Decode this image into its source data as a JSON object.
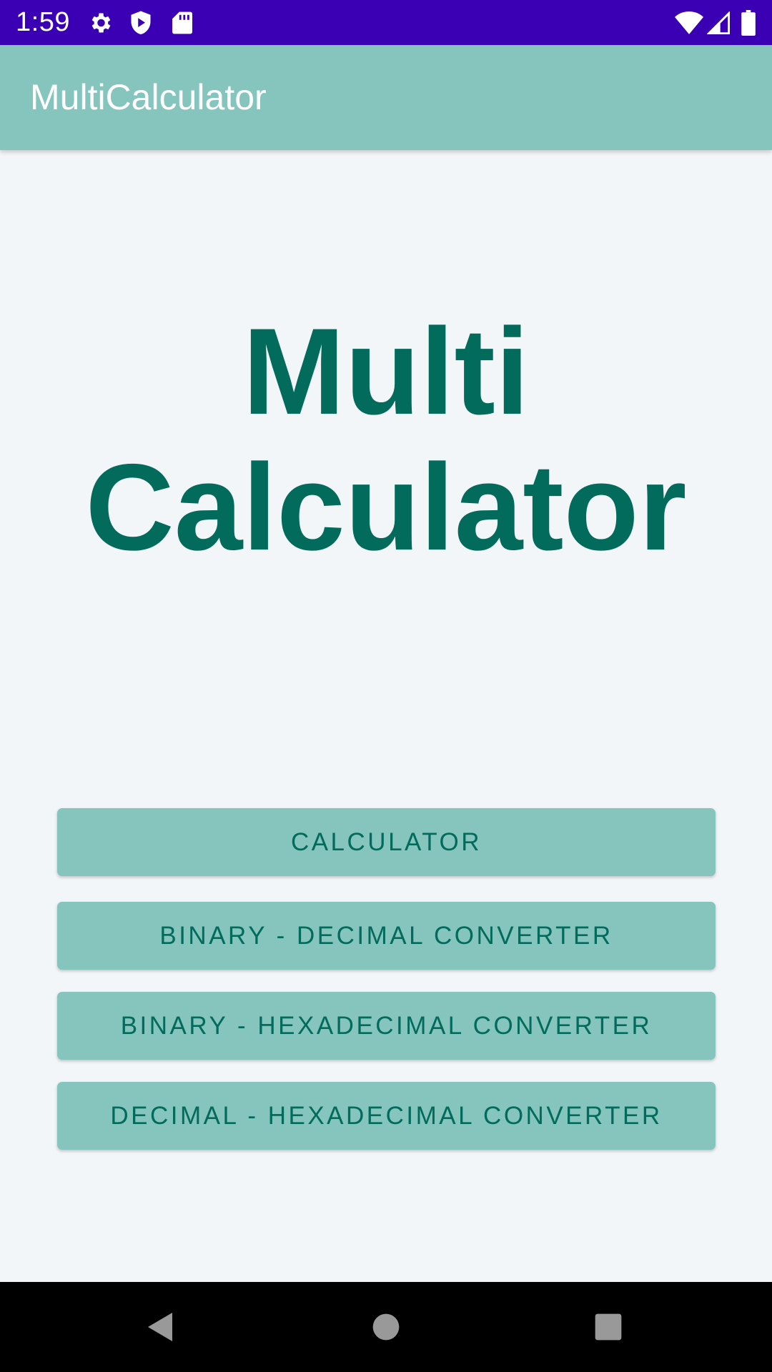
{
  "status_bar": {
    "time": "1:59",
    "icons": [
      "settings-icon",
      "shield-play-icon",
      "sd-card-icon",
      "wifi-icon",
      "signal-icon",
      "battery-icon"
    ]
  },
  "app_bar": {
    "title": "MultiCalculator"
  },
  "hero": {
    "line1": "Multi",
    "line2": "Calculator"
  },
  "menu": {
    "calculator": "CALCULATOR",
    "binary_decimal": "BINARY - DECIMAL CONVERTER",
    "binary_hexadecimal": "BINARY - HEXADECIMAL CONVERTER",
    "decimal_hexadecimal": "DECIMAL - HEXADECIMAL CONVERTER"
  },
  "nav_bar": {
    "icons": [
      "back-icon",
      "home-icon",
      "recents-icon"
    ]
  },
  "colors": {
    "status_bar": "#3b00b3",
    "app_bar": "#85c5bd",
    "accent_text": "#036b5b",
    "background": "#f3f6f9"
  }
}
